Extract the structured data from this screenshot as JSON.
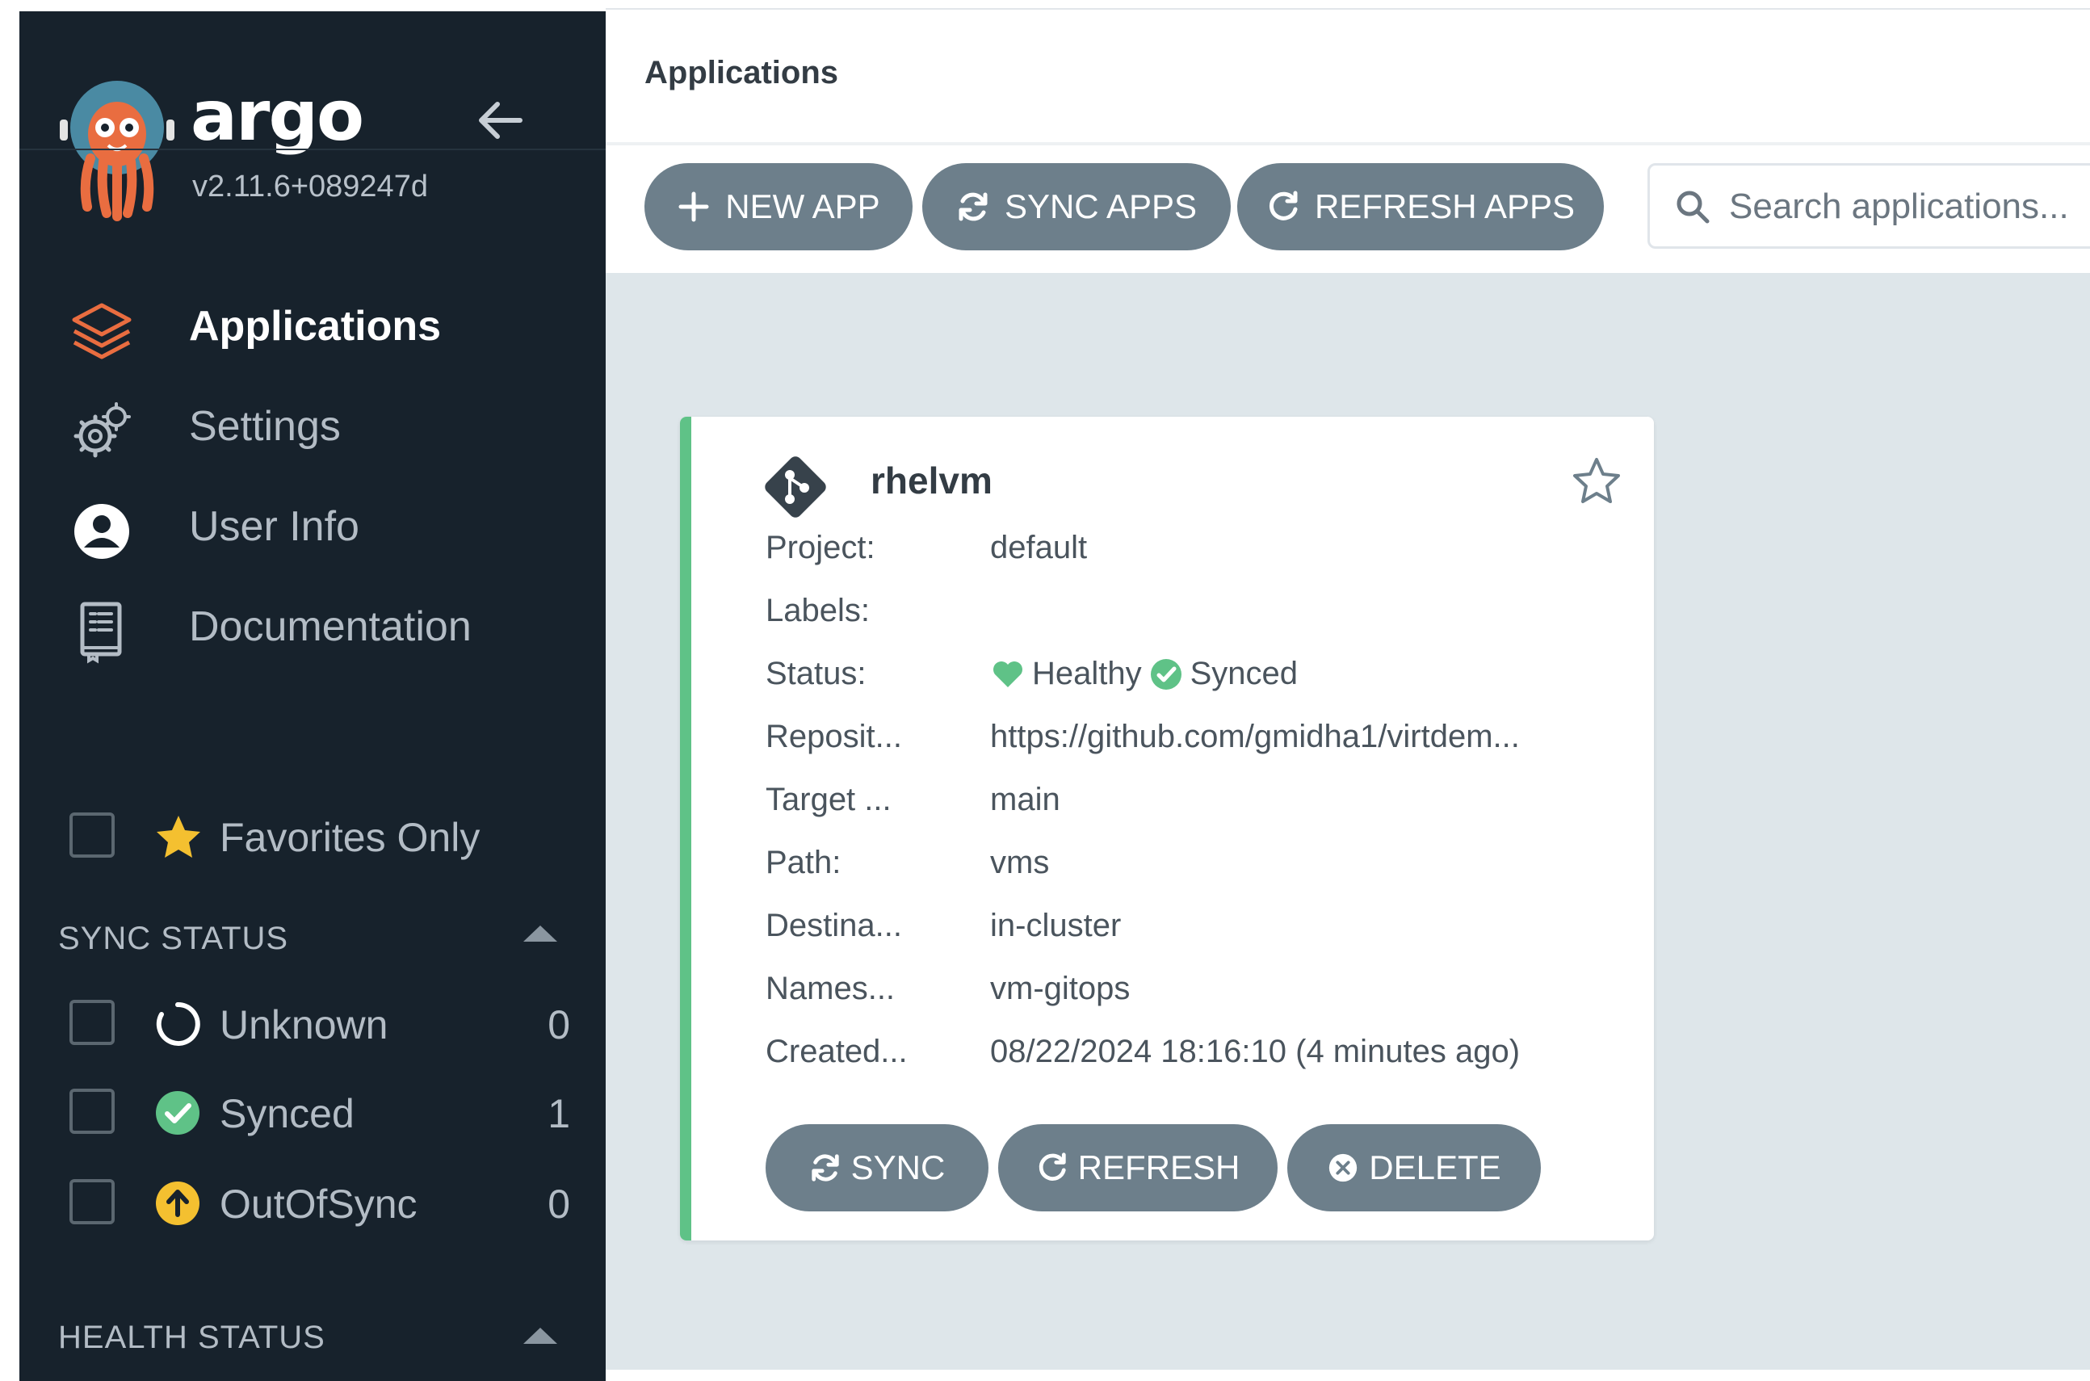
{
  "brand": {
    "name": "argo",
    "version": "v2.11.6+089247d"
  },
  "nav": {
    "applications": "Applications",
    "settings": "Settings",
    "user_info": "User Info",
    "documentation": "Documentation"
  },
  "filters": {
    "favorites_label": "Favorites Only",
    "sync_status_title": "SYNC STATUS",
    "sync_status": [
      {
        "label": "Unknown",
        "count": "0"
      },
      {
        "label": "Synced",
        "count": "1"
      },
      {
        "label": "OutOfSync",
        "count": "0"
      }
    ],
    "health_status_title": "HEALTH STATUS"
  },
  "header": {
    "title": "Applications"
  },
  "toolbar": {
    "new_app": "NEW APP",
    "sync_apps": "SYNC APPS",
    "refresh_apps": "REFRESH APPS",
    "search_placeholder": "Search applications..."
  },
  "app": {
    "name": "rhelvm",
    "fields": [
      {
        "key": "Project:",
        "value": "default"
      },
      {
        "key": "Labels:",
        "value": ""
      },
      {
        "key": "Status:",
        "value": ""
      },
      {
        "key": "Reposit...",
        "value": "https://github.com/gmidha1/virtdem..."
      },
      {
        "key": "Target ...",
        "value": "main"
      },
      {
        "key": "Path:",
        "value": "vms"
      },
      {
        "key": "Destina...",
        "value": "in-cluster"
      },
      {
        "key": "Names...",
        "value": "vm-gitops"
      },
      {
        "key": "Created...",
        "value": "08/22/2024 18:16:10  (4 minutes ago)"
      }
    ],
    "health": "Healthy",
    "sync": "Synced",
    "actions": {
      "sync": "SYNC",
      "refresh": "REFRESH",
      "delete": "DELETE"
    }
  },
  "colors": {
    "sidebar_bg": "#17222c",
    "content_bg": "#dee6ea",
    "button_bg": "#6d7f8b",
    "healthy_green": "#5fc287",
    "outofsync_yellow": "#f4c030",
    "argo_orange": "#e96d40"
  },
  "icons": {
    "applications": "layers-icon",
    "settings": "gears-icon",
    "user_info": "user-circle-icon",
    "documentation": "book-icon",
    "favorites": "star-icon",
    "search": "search-icon"
  }
}
